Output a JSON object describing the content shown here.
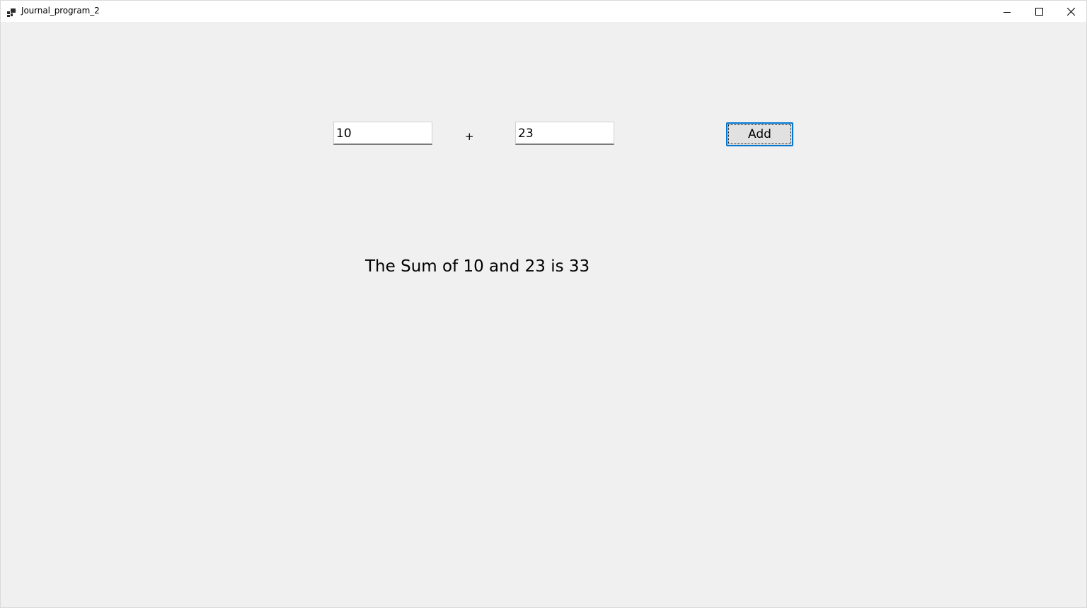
{
  "window": {
    "title": "Journal_program_2",
    "app_icon": "app-icon",
    "controls": {
      "minimize_icon": "minimize-icon",
      "maximize_icon": "maximize-icon",
      "close_icon": "close-icon"
    }
  },
  "form": {
    "first_number": "10",
    "operator_label": "+",
    "second_number": "23",
    "add_button_label": "Add",
    "result_text": "The Sum of 10 and 23 is 33"
  },
  "colors": {
    "background": "#f0f0f0",
    "titlebar": "#ffffff",
    "focus_border": "#0078d4"
  }
}
